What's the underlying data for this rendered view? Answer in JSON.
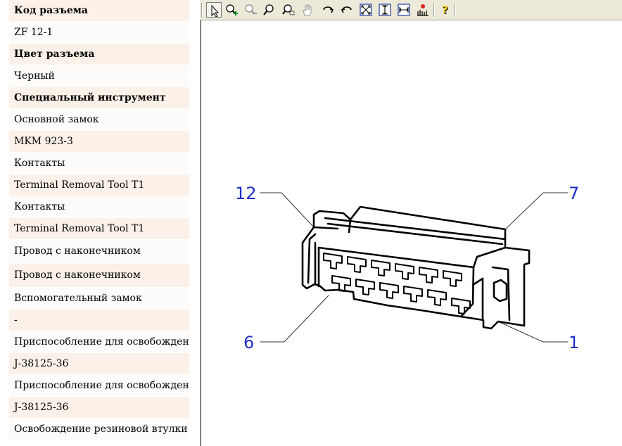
{
  "rows": [
    {
      "text": "Код разъема",
      "header": true
    },
    {
      "text": "ZF 12-1",
      "header": false
    },
    {
      "text": "Цвет разъема",
      "header": true
    },
    {
      "text": "Черный",
      "header": false
    },
    {
      "text": "Специальный инструмент",
      "header": true
    },
    {
      "text": "Основной замок",
      "header": false
    },
    {
      "text": "MKM 923-3",
      "header": false
    },
    {
      "text": "Контакты",
      "header": false
    },
    {
      "text": "Terminal Removal Tool T1",
      "header": false
    },
    {
      "text": "Контакты",
      "header": false
    },
    {
      "text": "Terminal Removal Tool T1",
      "header": false
    },
    {
      "text": "Провод с наконечником",
      "header": false
    },
    {
      "text": "Провод с наконечником",
      "header": false
    },
    {
      "text": "Вспомогательный замок",
      "header": false
    },
    {
      "text": "-",
      "header": false
    },
    {
      "text": "Приспособление для освобождения",
      "header": false
    },
    {
      "text": "J-38125-36",
      "header": false
    },
    {
      "text": "Приспособление для освобождения",
      "header": false
    },
    {
      "text": "J-38125-36",
      "header": false
    },
    {
      "text": "Освобождение резиновой втулки",
      "header": false
    }
  ],
  "toolbar": {
    "buttons": [
      {
        "icon": "select-arrow-icon",
        "active": true
      },
      {
        "icon": "zoom-in-icon",
        "active": false
      },
      {
        "icon": "zoom-out-icon",
        "active": false
      },
      {
        "icon": "zoom-icon",
        "active": false
      },
      {
        "icon": "zoom-window-icon",
        "active": false
      },
      {
        "icon": "pan-hand-icon",
        "active": false
      },
      {
        "icon": "rotate-cw-icon",
        "active": false
      },
      {
        "icon": "rotate-ccw-icon",
        "active": false
      },
      {
        "icon": "fit-all-icon",
        "active": false
      },
      {
        "icon": "fit-height-icon",
        "active": false
      },
      {
        "icon": "fit-width-icon",
        "active": false
      },
      {
        "icon": "highlight-icon",
        "active": false
      },
      {
        "icon": "help-icon",
        "active": false
      }
    ]
  },
  "drawing": {
    "pin_labels": {
      "pin_12": "12",
      "pin_7": "7",
      "pin_6": "6",
      "pin_1": "1"
    }
  },
  "colors": {
    "row_shade": "#fbf1e8",
    "row_plain": "#fefcfb",
    "label_blue": "#1f2fc9",
    "toolbar_bg": "#ece9d8"
  }
}
